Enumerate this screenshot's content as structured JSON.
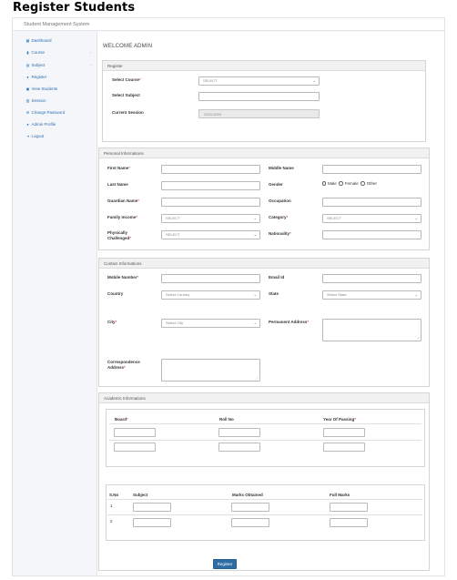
{
  "page_heading": "Register Students",
  "app": {
    "brand": "Student Management System"
  },
  "sidebar": {
    "items": [
      {
        "label": "Dashboard",
        "icon": "dashboard-icon"
      },
      {
        "label": "Course",
        "icon": "book-icon",
        "has_caret": true
      },
      {
        "label": "Subject",
        "icon": "subject-icon",
        "has_caret": true
      },
      {
        "label": "Register",
        "icon": "user-icon"
      },
      {
        "label": "View Students",
        "icon": "users-icon"
      },
      {
        "label": "Session",
        "icon": "calendar-icon"
      },
      {
        "label": "Change Password",
        "icon": "gear-icon"
      },
      {
        "label": "Admin Profile",
        "icon": "user-icon"
      },
      {
        "label": "Logout",
        "icon": "logout-icon"
      }
    ],
    "caret_glyph": "‹"
  },
  "welcome": "WELCOME ADMIN",
  "register": {
    "title": "Register",
    "course_label": "Select Course",
    "course_value": "SELECT",
    "subject_label": "Select Subject",
    "session_label": "Current Session",
    "session_value": "2023-2024"
  },
  "personal": {
    "title": "Personal Informations",
    "first_name": "First Name",
    "middle_name": "Middle Name",
    "last_name": "Last Name",
    "gender": "Gender",
    "gender_options": [
      "Male",
      "Female",
      "Other"
    ],
    "guardian_name": "Guardian Name",
    "occupation": "Occupation",
    "family_income": "Family Income",
    "family_income_value": "SELECT",
    "category": "Category",
    "category_value": "SELECT",
    "physically_challenged_1": "Physically",
    "physically_challenged_2": "Challenged",
    "physically_challenged_value": "SELECT",
    "nationality": "Nationality"
  },
  "contact": {
    "title": "Contact Informations",
    "mobile": "Mobile Number",
    "email": "Email Id",
    "country": "Country",
    "country_value": "Select Country",
    "state": "State",
    "state_value": "Select State",
    "city": "City",
    "city_value": "Select City",
    "permanent_address": "Permanent Address",
    "correspondence_1": "Correspondence",
    "correspondence_2": "Address"
  },
  "academic": {
    "title": "Academic Informations",
    "columns": [
      "Board",
      "Roll No",
      "Year Of Passing"
    ],
    "marks_columns": [
      "S.No",
      "Subject",
      "Marks Obtained",
      "Full Marks"
    ],
    "marks_rows": [
      "1",
      "2"
    ]
  },
  "submit_label": "Register",
  "required_mark": "*",
  "dropdown_glyph": "⌄",
  "resize_glyph": "⟋"
}
